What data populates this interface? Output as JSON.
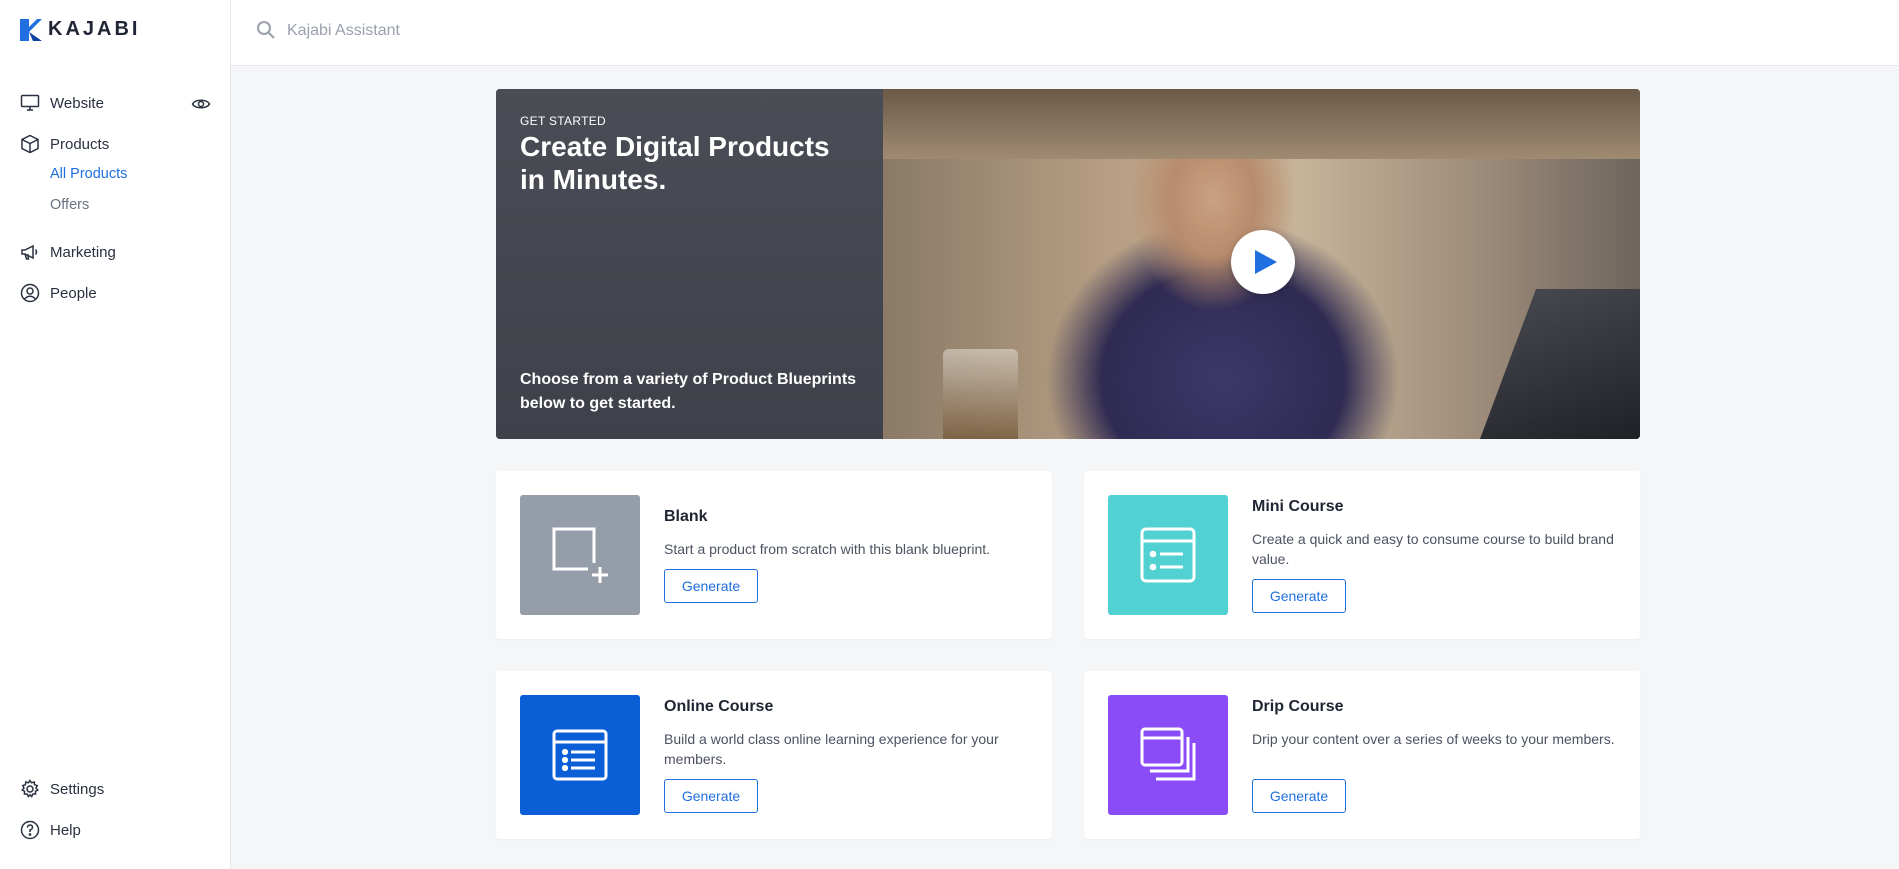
{
  "brand": {
    "name": "KAJABI",
    "color": "#1f6fe0"
  },
  "search": {
    "placeholder": "Kajabi Assistant",
    "value": ""
  },
  "sidebar": {
    "items": [
      {
        "label": "Website",
        "icon": "monitor-icon"
      },
      {
        "label": "Products",
        "icon": "box-icon",
        "children": [
          {
            "label": "All Products",
            "active": true
          },
          {
            "label": "Offers",
            "active": false
          }
        ]
      },
      {
        "label": "Marketing",
        "icon": "megaphone-icon"
      },
      {
        "label": "People",
        "icon": "user-circle-icon"
      }
    ],
    "bottom": [
      {
        "label": "Settings",
        "icon": "gear-icon"
      },
      {
        "label": "Help",
        "icon": "help-icon"
      }
    ]
  },
  "hero": {
    "eyebrow": "GET STARTED",
    "title": "Create Digital Products in Minutes.",
    "subtitle": "Choose from a variety of Product Blueprints below to get started.",
    "play_icon": "play-icon"
  },
  "blueprints": [
    {
      "title": "Blank",
      "description": "Start a product from scratch with this blank blueprint.",
      "button": "Generate",
      "color": "#959da8",
      "icon": "blank-square-plus-icon"
    },
    {
      "title": "Mini Course",
      "description": "Create a quick and easy to consume course to build brand value.",
      "button": "Generate",
      "color": "#52d1d3",
      "icon": "mini-course-icon"
    },
    {
      "title": "Online Course",
      "description": "Build a world class online learning experience for your members.",
      "button": "Generate",
      "color": "#0a5fd6",
      "icon": "online-course-icon"
    },
    {
      "title": "Drip Course",
      "description": "Drip your content over a series of weeks to your members.",
      "button": "Generate",
      "color": "#8a4cf7",
      "icon": "drip-course-icon"
    }
  ]
}
